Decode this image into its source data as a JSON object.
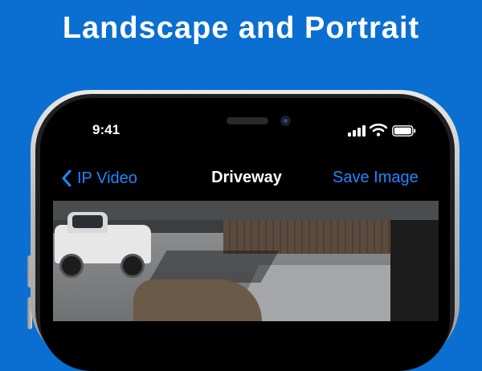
{
  "banner": {
    "title": "Landscape and Portrait"
  },
  "status_bar": {
    "time": "9:41",
    "icons": [
      "cellular-signal-icon",
      "wifi-icon",
      "battery-icon"
    ]
  },
  "nav_bar": {
    "back_label": "IP Video",
    "title": "Driveway",
    "action_label": "Save Image"
  },
  "colors": {
    "background": "#0a6fd0",
    "accent": "#1e87ff",
    "screen": "#000000"
  },
  "video": {
    "icon": "camera-feed-image"
  }
}
